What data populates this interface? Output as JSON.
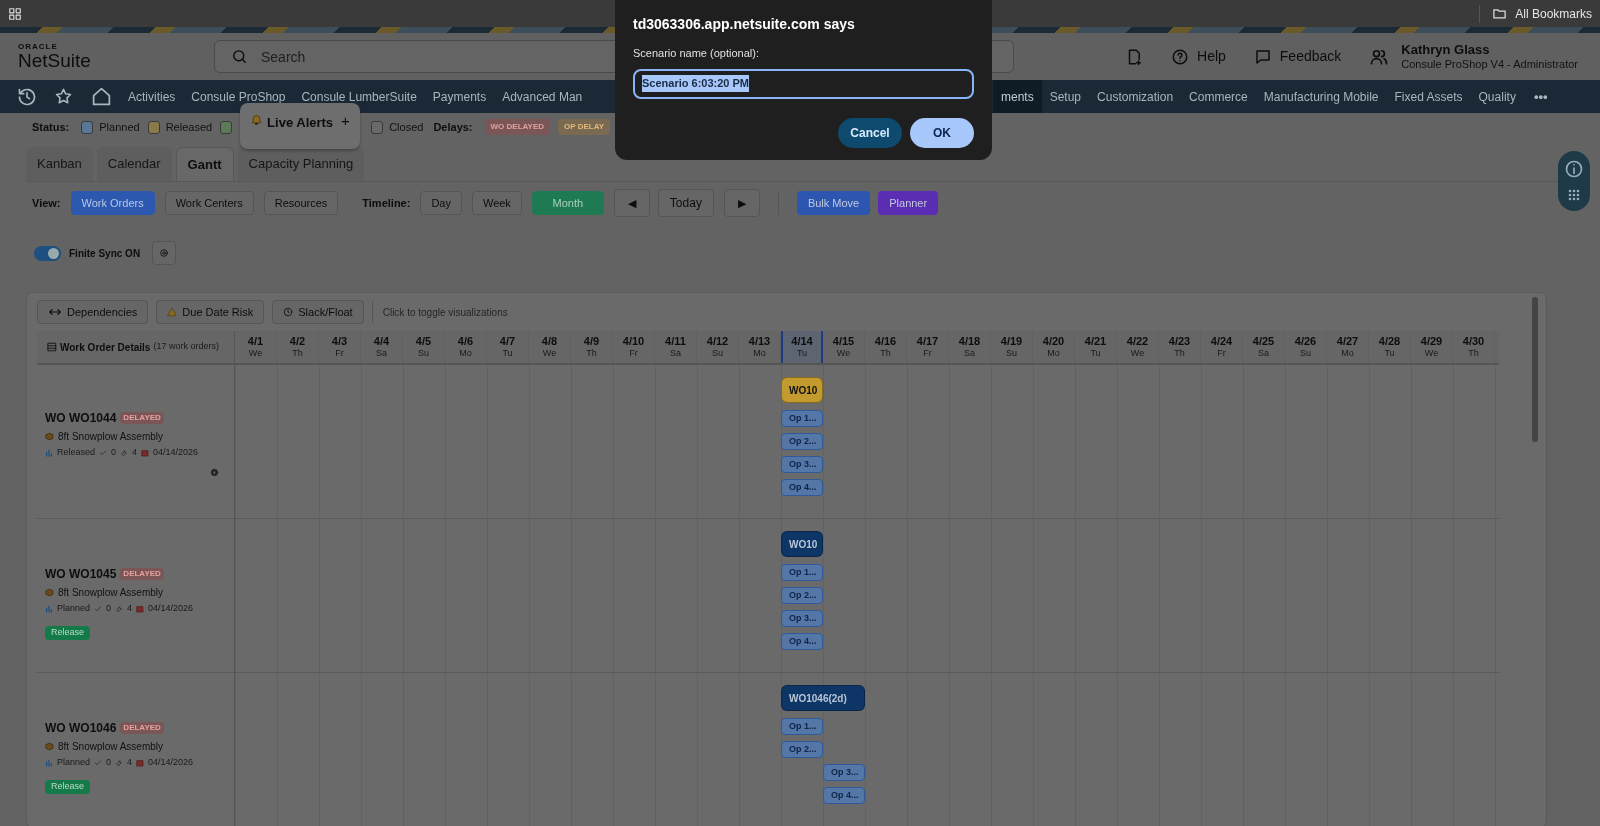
{
  "browser": {
    "bookmarks": "All Bookmarks"
  },
  "header": {
    "logo_top": "ORACLE",
    "logo_main": "NetSuite",
    "search_placeholder": "Search",
    "help": "Help",
    "feedback": "Feedback",
    "user_name": "Kathryn Glass",
    "user_role": "Consule ProShop V4 - Administrator"
  },
  "nav": {
    "left_items": [
      {
        "label": "Activities",
        "selected": false
      },
      {
        "label": "Consule ProShop",
        "selected": false
      },
      {
        "label": "Consule LumberSuite",
        "selected": false
      },
      {
        "label": "Payments",
        "selected": false
      },
      {
        "label": "Advanced Man",
        "selected": false
      }
    ],
    "right_items": [
      {
        "label": "ments",
        "selected": true
      },
      {
        "label": "Setup",
        "selected": false
      },
      {
        "label": "Customization",
        "selected": false
      },
      {
        "label": "Commerce",
        "selected": false
      },
      {
        "label": "Manufacturing Mobile",
        "selected": false
      },
      {
        "label": "Fixed Assets",
        "selected": false
      },
      {
        "label": "Quality",
        "selected": false
      }
    ],
    "more": "•••"
  },
  "status_legend": {
    "label": "Status:",
    "items": [
      {
        "label": "Planned",
        "color": "#5a7796"
      },
      {
        "label": "Released",
        "color": "#8a7a4a"
      },
      {
        "color": "#5b7a55"
      },
      {
        "label": "Closed",
        "color": "#6a6a6a"
      }
    ]
  },
  "delays": {
    "label": "Delays:",
    "items": [
      {
        "label": "WO DELAYED",
        "color": "#7a5656"
      },
      {
        "label": "OP DELAY",
        "color": "#7a6a52"
      }
    ]
  },
  "live_alerts": {
    "label": "Live Alerts",
    "action": "+"
  },
  "view_tabs": [
    {
      "label": "Kanban",
      "selected": false
    },
    {
      "label": "Calendar",
      "selected": false
    },
    {
      "label": "Gantt",
      "selected": true
    },
    {
      "label": "Capacity Planning",
      "selected": false
    }
  ],
  "toolbar": {
    "view_label": "View:",
    "views": [
      {
        "label": "Work Orders",
        "selected": true
      },
      {
        "label": "Work Centers",
        "selected": false
      },
      {
        "label": "Resources",
        "selected": false
      }
    ],
    "timeline_label": "Timeline:",
    "timeline": [
      {
        "label": "Day",
        "selected": false
      },
      {
        "label": "Week",
        "selected": false
      },
      {
        "label": "Month",
        "selected": true
      }
    ],
    "prev": "◀",
    "today": "Today",
    "next": "▶",
    "actions": [
      {
        "label": "Bulk Move",
        "color": "#2c56b0"
      },
      {
        "label": "Planner",
        "color": "#5b2db3"
      }
    ]
  },
  "finite_sync": {
    "label": "Finite Sync ON",
    "on": true
  },
  "gantt": {
    "toggles": [
      {
        "kind": "arrows",
        "label": "Dependencies"
      },
      {
        "kind": "warning",
        "label": "Due Date Risk"
      },
      {
        "kind": "clock",
        "label": "Slack/Float"
      }
    ],
    "hint": "Click to toggle visualizations",
    "details_title": "Work Order Details",
    "details_count": "(17 work orders)",
    "days": [
      {
        "date": "4/1",
        "weekday": "We",
        "today": false
      },
      {
        "date": "4/2",
        "weekday": "Th",
        "today": false
      },
      {
        "date": "4/3",
        "weekday": "Fr",
        "today": false
      },
      {
        "date": "4/4",
        "weekday": "Sa",
        "today": false
      },
      {
        "date": "4/5",
        "weekday": "Su",
        "today": false
      },
      {
        "date": "4/6",
        "weekday": "Mo",
        "today": false
      },
      {
        "date": "4/7",
        "weekday": "Tu",
        "today": false
      },
      {
        "date": "4/8",
        "weekday": "We",
        "today": false
      },
      {
        "date": "4/9",
        "weekday": "Th",
        "today": false
      },
      {
        "date": "4/10",
        "weekday": "Fr",
        "today": false
      },
      {
        "date": "4/11",
        "weekday": "Sa",
        "today": false
      },
      {
        "date": "4/12",
        "weekday": "Su",
        "today": false
      },
      {
        "date": "4/13",
        "weekday": "Mo",
        "today": false
      },
      {
        "date": "4/14",
        "weekday": "Tu",
        "today": true
      },
      {
        "date": "4/15",
        "weekday": "We",
        "today": false
      },
      {
        "date": "4/16",
        "weekday": "Th",
        "today": false
      },
      {
        "date": "4/17",
        "weekday": "Fr",
        "today": false
      },
      {
        "date": "4/18",
        "weekday": "Sa",
        "today": false
      },
      {
        "date": "4/19",
        "weekday": "Su",
        "today": false
      },
      {
        "date": "4/20",
        "weekday": "Mo",
        "today": false
      },
      {
        "date": "4/21",
        "weekday": "Tu",
        "today": false
      },
      {
        "date": "4/22",
        "weekday": "We",
        "today": false
      },
      {
        "date": "4/23",
        "weekday": "Th",
        "today": false
      },
      {
        "date": "4/24",
        "weekday": "Fr",
        "today": false
      },
      {
        "date": "4/25",
        "weekday": "Sa",
        "today": false
      },
      {
        "date": "4/26",
        "weekday": "Su",
        "today": false
      },
      {
        "date": "4/27",
        "weekday": "Mo",
        "today": false
      },
      {
        "date": "4/28",
        "weekday": "Tu",
        "today": false
      },
      {
        "date": "4/29",
        "weekday": "We",
        "today": false
      },
      {
        "date": "4/30",
        "weekday": "Th",
        "today": false
      }
    ],
    "rows": [
      {
        "title": "WO WO1044",
        "badge": "DELAYED",
        "product": "8ft Snowplow Assembly",
        "status": "Released",
        "checks": "0",
        "tools": "4",
        "date": "04/14/2026",
        "action": {
          "kind": "gear"
        },
        "wo_bar": {
          "label": "WO10",
          "color": "#c29a2e",
          "wide": false
        },
        "ops": [
          "Op 1...",
          "Op 2...",
          "Op 3...",
          "Op 4..."
        ]
      },
      {
        "title": "WO WO1045",
        "badge": "DELAYED",
        "product": "8ft Snowplow Assembly",
        "status": "Planned",
        "checks": "0",
        "tools": "4",
        "date": "04/14/2026",
        "action": {
          "kind": "release",
          "label": "Release"
        },
        "wo_bar": {
          "label": "WO10",
          "color": "#0d3566",
          "wide": false
        },
        "ops": [
          "Op 1...",
          "Op 2...",
          "Op 3...",
          "Op 4..."
        ]
      },
      {
        "title": "WO WO1046",
        "badge": "DELAYED",
        "product": "8ft Snowplow Assembly",
        "status": "Planned",
        "checks": "0",
        "tools": "4",
        "date": "04/14/2026",
        "action": {
          "kind": "release",
          "label": "Release"
        },
        "wo_bar": {
          "label": "WO1046(2d)",
          "color": "#0d3566",
          "wide": true
        },
        "ops": [
          "Op 1...",
          "Op 2..."
        ],
        "next_day_ops": [
          "Op 3...",
          "Op 4..."
        ]
      }
    ]
  },
  "dialog": {
    "title": "td3063306.app.netsuite.com says",
    "prompt": "Scenario name (optional):",
    "value": "Scenario 6:03:20 PM",
    "value_selected": true,
    "cancel": "Cancel",
    "ok": "OK"
  }
}
